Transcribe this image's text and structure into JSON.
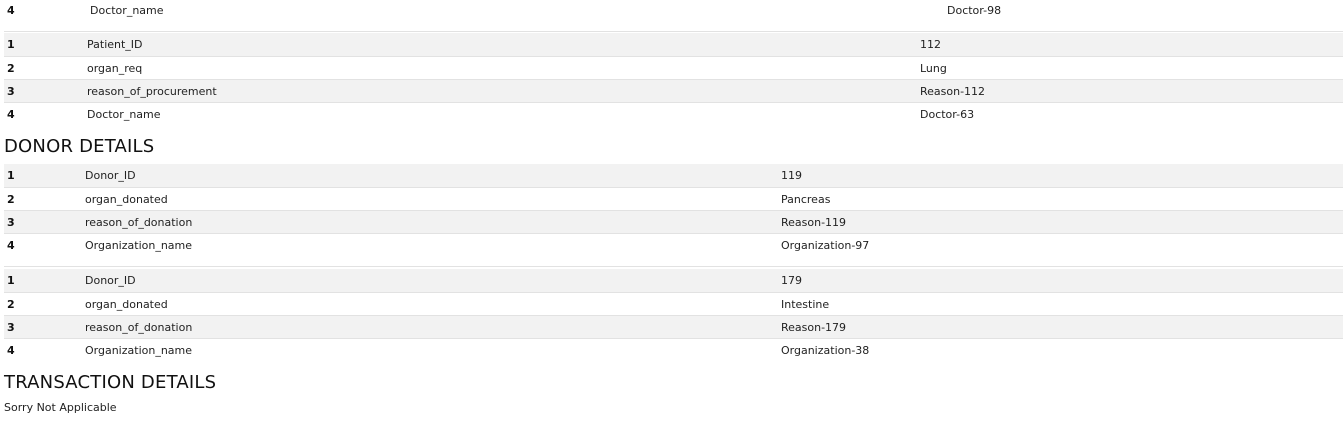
{
  "recipient_tail": {
    "rows": [
      {
        "num": "4",
        "field": "Doctor_name",
        "value": "Doctor-98"
      }
    ]
  },
  "recipient_2": {
    "rows": [
      {
        "num": "1",
        "field": "Patient_ID",
        "value": "112"
      },
      {
        "num": "2",
        "field": "organ_req",
        "value": "Lung"
      },
      {
        "num": "3",
        "field": "reason_of_procurement",
        "value": "Reason-112"
      },
      {
        "num": "4",
        "field": "Doctor_name",
        "value": "Doctor-63"
      }
    ]
  },
  "donor_section": {
    "title": "DONOR DETAILS",
    "tables": [
      {
        "rows": [
          {
            "num": "1",
            "field": "Donor_ID",
            "value": "119"
          },
          {
            "num": "2",
            "field": "organ_donated",
            "value": "Pancreas"
          },
          {
            "num": "3",
            "field": "reason_of_donation",
            "value": "Reason-119"
          },
          {
            "num": "4",
            "field": "Organization_name",
            "value": "Organization-97"
          }
        ]
      },
      {
        "rows": [
          {
            "num": "1",
            "field": "Donor_ID",
            "value": "179"
          },
          {
            "num": "2",
            "field": "organ_donated",
            "value": "Intestine"
          },
          {
            "num": "3",
            "field": "reason_of_donation",
            "value": "Reason-179"
          },
          {
            "num": "4",
            "field": "Organization_name",
            "value": "Organization-38"
          }
        ]
      }
    ]
  },
  "transaction_section": {
    "title": "TRANSACTION DETAILS",
    "message": "Sorry Not Applicable"
  }
}
